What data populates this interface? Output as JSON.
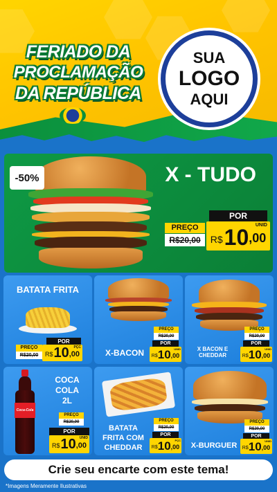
{
  "header": {
    "title_lines": [
      "FERIADO DA",
      "PROCLAMAÇÃO",
      "DA REPÚBLICA"
    ],
    "logo_lines": [
      "SUA",
      "LOGO",
      "AQUI"
    ]
  },
  "hero": {
    "discount": "-50%",
    "name": "X - TUDO",
    "por_label": "POR",
    "preco_label": "PREÇO",
    "old_price": "R$20,00",
    "currency": "R$",
    "price_int": "10",
    "price_cents": ",00",
    "unit": "UNID"
  },
  "cards": [
    {
      "name": "BATATA FRITA",
      "preco_label": "PREÇO",
      "old_price": "R$20,00",
      "por_label": "POR",
      "currency": "R$",
      "price_int": "10",
      "price_cents": ",00",
      "unit": "PÇC"
    },
    {
      "name": "X-BACON",
      "preco_label": "PREÇO",
      "old_price": "R$20,00",
      "por_label": "POR",
      "currency": "R$",
      "price_int": "10",
      "price_cents": ",00",
      "unit": "UNID"
    },
    {
      "name_lines": [
        "X BACON E",
        "CHEDDAR"
      ],
      "preco_label": "PREÇO",
      "old_price": "R$20,00",
      "por_label": "POR",
      "currency": "R$",
      "price_int": "10",
      "price_cents": ",00",
      "unit": "UNID"
    },
    {
      "name_lines": [
        "COCA",
        "COLA",
        "2L"
      ],
      "preco_label": "PREÇO",
      "old_price": "R$20,00",
      "por_label": "POR",
      "currency": "R$",
      "price_int": "10",
      "price_cents": ",00",
      "unit": "UNID",
      "bottle_brand": "Coca-Cola"
    },
    {
      "name_lines": [
        "BATATA",
        "FRITA COM",
        "CHEDDAR"
      ],
      "preco_label": "PREÇO",
      "old_price": "R$20,00",
      "por_label": "POR",
      "currency": "R$",
      "price_int": "10",
      "price_cents": ",00",
      "unit": "PÇC"
    },
    {
      "name": "X-BURGUER",
      "preco_label": "PREÇO",
      "old_price": "R$20,00",
      "por_label": "POR",
      "currency": "R$",
      "price_int": "10",
      "price_cents": ",00",
      "unit": "UNID"
    }
  ],
  "footer": {
    "cta": "Crie seu encarte com este tema!",
    "disclaimer": "*Imagens Meramente Ilustrativas"
  },
  "colors": {
    "yellow": "#ffd500",
    "green": "#0e9a45",
    "blue": "#1d7fdc",
    "black": "#111111"
  }
}
